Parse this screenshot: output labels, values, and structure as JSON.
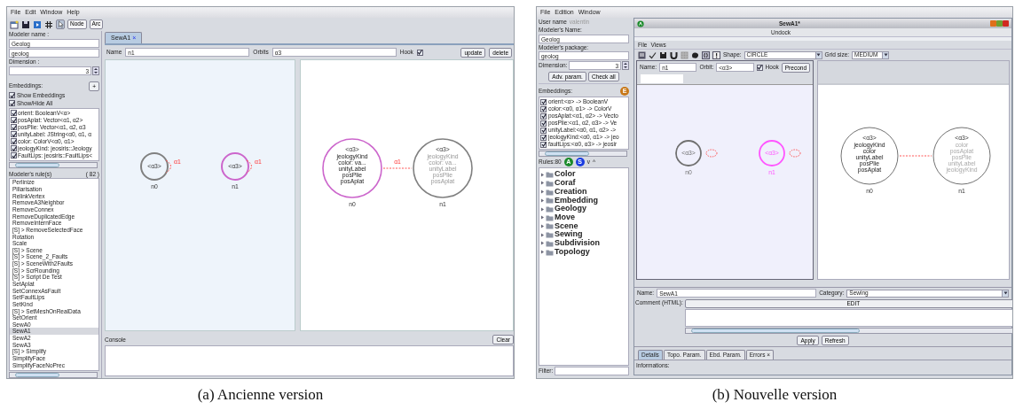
{
  "old_version": {
    "caption": "(a) Ancienne version",
    "menu": [
      "File",
      "Edit",
      "Window",
      "Help"
    ],
    "pointer_tool_selected": true,
    "toolbar_buttons": [
      "Node",
      "Arc"
    ],
    "sidebar": {
      "modeler_name_label": "Modeler name :",
      "fields": [
        "Geolog",
        "geolog"
      ],
      "dimension_label": "Dimension :",
      "dimension": "3",
      "embeddings_label": "Embeddings:",
      "add_button": "+",
      "options": [
        {
          "label": "Show Embeddings",
          "checked": true
        },
        {
          "label": "Show/Hide All",
          "checked": true
        }
      ],
      "embeddings": [
        {
          "label": "orient: BooleanV<α>",
          "checked": true
        },
        {
          "label": "posAplat: Vector<α1, α2>",
          "checked": true
        },
        {
          "label": "posPlie: Vector<α1, α2, α3",
          "checked": true
        },
        {
          "label": "unityLabel: JString<α0, α1, α",
          "checked": true
        },
        {
          "label": "color: ColorV<α0, α1>",
          "checked": true
        },
        {
          "label": "jeologyKind: jeosiris::Jeology",
          "checked": true
        },
        {
          "label": "FaultLips: jeosiris::FaultLips<",
          "checked": true
        }
      ],
      "rules_label": "Modeler's rule(s)",
      "rules_count": "( 82 )",
      "rules": [
        {
          "label": "Perlinize",
          "selected": false
        },
        {
          "label": "Pillarisation",
          "selected": false
        },
        {
          "label": "RelinkVertex",
          "selected": false
        },
        {
          "label": "RemoveA3Neighbor",
          "selected": false
        },
        {
          "label": "RemoveConnex",
          "selected": false
        },
        {
          "label": "RemoveDuplicatedEdge",
          "selected": false
        },
        {
          "label": "RemoveInternFace",
          "selected": false
        },
        {
          "label": "[S] > RemoveSelectedFace",
          "selected": false
        },
        {
          "label": "Rotation",
          "selected": false
        },
        {
          "label": "Scale",
          "selected": false
        },
        {
          "label": "[S] > Scene",
          "selected": false
        },
        {
          "label": "[S] > Scene_2_Faults",
          "selected": false
        },
        {
          "label": "[S] > SceneWith2Faults",
          "selected": false
        },
        {
          "label": "[S] > ScrRounding",
          "selected": false
        },
        {
          "label": "[S] > Script De Test",
          "selected": false
        },
        {
          "label": "SetAplat",
          "selected": false
        },
        {
          "label": "SetConnexAsFault",
          "selected": false
        },
        {
          "label": "SetFaultLips",
          "selected": false
        },
        {
          "label": "SetKind",
          "selected": false
        },
        {
          "label": "[S] > SetMeshOnRealData",
          "selected": false
        },
        {
          "label": "SetOrient",
          "selected": false
        },
        {
          "label": "SewA0",
          "selected": false
        },
        {
          "label": "SewA1",
          "selected": true
        },
        {
          "label": "SewA2",
          "selected": false
        },
        {
          "label": "SewA3",
          "selected": false
        },
        {
          "label": "[S] > Simplify",
          "selected": false
        },
        {
          "label": "SimplifyFace",
          "selected": false
        },
        {
          "label": "SimplifyFaceNoPrec",
          "selected": false
        }
      ]
    },
    "tab": {
      "label": "SewA1",
      "close": "×"
    },
    "node_bar": {
      "name_label": "Name",
      "name": "n1",
      "orbits_label": "Orbits",
      "orbits": "α3",
      "hook_label": "Hook",
      "hook": true,
      "buttons": [
        "update",
        "delete"
      ]
    },
    "left_graph": {
      "nodes": [
        {
          "name": "n0",
          "orbit": "<α3>",
          "color": "#808080",
          "loop": "α1"
        },
        {
          "name": "n1",
          "orbit": "<α3>",
          "color": "#cc66cc",
          "loop": "α1"
        }
      ]
    },
    "right_graph": {
      "nodes": [
        {
          "name": "n0",
          "orbit": "<α3>",
          "color": "#cc66cc",
          "faded": false,
          "embeddings": [
            "jeologyKind",
            "color: va...",
            "unityLabel",
            "posPlie",
            "posAplat"
          ]
        },
        {
          "name": "n1",
          "orbit": "<α3>",
          "color": "#808080",
          "faded": true,
          "embeddings": [
            "jeologyKind",
            "color: va...",
            "unityLabel",
            "posPlie",
            "posAplat"
          ]
        }
      ],
      "edge": {
        "label": "α1"
      }
    },
    "console": {
      "label": "Console",
      "button": "Clear"
    }
  },
  "new_version": {
    "caption": "(b) Nouvelle version",
    "menu": [
      "File",
      "Edition",
      "Window"
    ],
    "sidebar": {
      "user_label": "User name",
      "user": "valentin",
      "modeler_name_label": "Modeler's Name:",
      "modeler_name": "Geolog",
      "package_label": "Modeler's package:",
      "package": "geolog",
      "dimension_label": "Dimension:",
      "dimension": "3",
      "buttons": [
        "Adv. param.",
        "Check all"
      ],
      "embeddings_label": "Embeddings:",
      "embedding_button": {
        "letter": "E",
        "color": "#c87818"
      },
      "embeddings": [
        {
          "label": "orient:<α> -> BooleanV",
          "checked": true
        },
        {
          "label": "color:<α0, α1> -> ColorV",
          "checked": true
        },
        {
          "label": "posAplat:<α1, α2> -> Vecto",
          "checked": true
        },
        {
          "label": "posPlie:<α1, α2, α3> -> Ve",
          "checked": true
        },
        {
          "label": "unityLabel:<α0, α1, α2> ->",
          "checked": true
        },
        {
          "label": "jeologyKind:<α0, α1> -> jeo",
          "checked": true
        },
        {
          "label": "faultLips:<α0, α3> -> jeosir",
          "checked": true
        }
      ],
      "rules_label": "Rules:80",
      "rule_buttons": [
        {
          "letter": "A",
          "color": "#1a8a2a"
        },
        {
          "letter": "S",
          "color": "#1a3ce0"
        }
      ],
      "sort": [
        "v",
        "^"
      ],
      "rule_folders": [
        "Color",
        "Coraf",
        "Creation",
        "Embedding",
        "Geology",
        "Move",
        "Scene",
        "Sewing",
        "Subdivision",
        "Topology"
      ],
      "filter_label": "Filter:"
    },
    "frame": {
      "title": "SewA1*",
      "undock": "Undock",
      "menu": [
        "File",
        "Views"
      ],
      "shape_label": "Shape:",
      "shape": "CIRCLE",
      "grid_label": "Grid size:",
      "grid": "MEDIUM"
    },
    "node_bar": {
      "name_label": "Name:",
      "name": "n1",
      "orbit_label": "Orbit:",
      "orbit": "<α3>",
      "hook_label": "Hook",
      "hook": true,
      "button": "Precond"
    },
    "left_graph": {
      "nodes": [
        {
          "name": "n0",
          "orbit": "<α3>",
          "color": "#707070"
        },
        {
          "name": "n1",
          "orbit": "<α3>",
          "color": "#ff55ff"
        }
      ]
    },
    "right_graph": {
      "nodes": [
        {
          "name": "n0",
          "orbit": "<α3>",
          "faded": false,
          "embeddings": [
            "jeologyKind",
            "color",
            "unityLabel",
            "posPlie",
            "posAplat"
          ]
        },
        {
          "name": "n1",
          "orbit": "<α3>",
          "faded": true,
          "embeddings": [
            "color",
            "posAplat",
            "posPlie",
            "unityLabel",
            "jeologyKind"
          ]
        }
      ]
    },
    "details": {
      "name_label": "Name:",
      "name": "SewA1",
      "category_label": "Category:",
      "category": "Sewing",
      "comment_label": "Comment (HTML):",
      "edit_button": "EDIT",
      "buttons": [
        "Apply",
        "Refresh"
      ],
      "tabs": [
        {
          "label": "Details",
          "selected": true
        },
        {
          "label": "Topo. Param.",
          "selected": false
        },
        {
          "label": "Ebd. Param.",
          "selected": false
        },
        {
          "label": "Errors",
          "selected": false,
          "close": "×"
        }
      ],
      "info_label": "Informations:"
    }
  }
}
